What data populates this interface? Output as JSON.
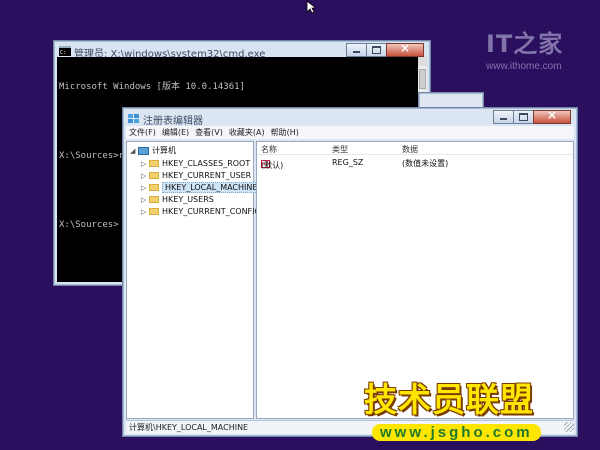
{
  "watermark_top": {
    "logo": "IT之家",
    "url": "www.ithome.com"
  },
  "cmd": {
    "title": "管理员: X:\\windows\\system32\\cmd.exe",
    "lines": [
      "Microsoft Windows [版本 10.0.14361]",
      "",
      "X:\\Sources>regedit",
      "",
      "X:\\Sources>"
    ]
  },
  "regedit": {
    "title": "注册表编辑器",
    "menu": [
      "文件(F)",
      "编辑(E)",
      "查看(V)",
      "收藏夹(A)",
      "帮助(H)"
    ],
    "tree": {
      "root": "计算机",
      "items": [
        "HKEY_CLASSES_ROOT",
        "HKEY_CURRENT_USER",
        "HKEY_LOCAL_MACHINE",
        "HKEY_USERS",
        "HKEY_CURRENT_CONFIG"
      ],
      "selected": "HKEY_LOCAL_MACHINE"
    },
    "columns": {
      "name": "名称",
      "type": "类型",
      "data": "数据"
    },
    "rows": [
      {
        "icon": "ab",
        "name": "(默认)",
        "type": "REG_SZ",
        "data": "(数值未设置)"
      }
    ],
    "status": "计算机\\HKEY_LOCAL_MACHINE"
  },
  "watermark_bottom": {
    "title": "技术员联盟",
    "url": "www.jsgho.com"
  }
}
